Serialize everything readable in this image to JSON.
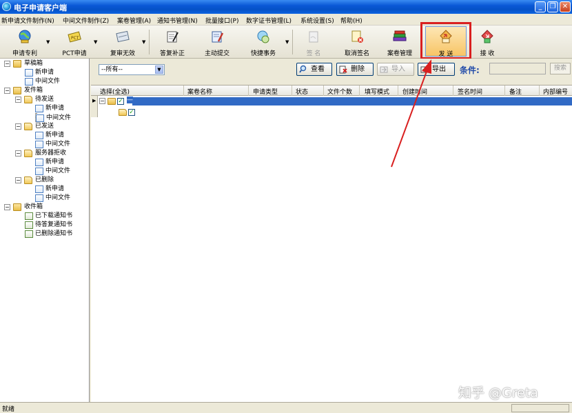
{
  "window": {
    "title": "电子申请客户端",
    "minimize": "_",
    "maximize": "❐",
    "close": "✕"
  },
  "menu": [
    "新申请文件制作(N)",
    "中间文件制作(Z)",
    "案卷管理(A)",
    "通知书管理(N)",
    "批量接口(P)",
    "数字证书管理(L)",
    "系统设置(S)",
    "帮助(H)"
  ],
  "toolbar": {
    "apply_patent": "申请专利",
    "pct_apply": "PCT申请",
    "review_invalid": "复审无效",
    "reply_supplement": "答复补正",
    "active_submit": "主动提交",
    "quick_tasks": "快捷事务",
    "sign": "签 名",
    "cancel_sign": "取消签名",
    "case_manage": "案卷管理",
    "send": "发 送",
    "receive": "接 收"
  },
  "tree": {
    "drafts": "草稿箱",
    "drafts_new": "新申请",
    "drafts_mid": "中间文件",
    "outbox": "发件箱",
    "pending": "待发送",
    "pending_new": "新申请",
    "pending_mid": "中间文件",
    "sent": "已发送",
    "sent_new": "新申请",
    "sent_mid": "中间文件",
    "rejected": "服务器拒收",
    "rejected_new": "新申请",
    "rejected_mid": "中间文件",
    "deleted": "已删除",
    "deleted_new": "新申请",
    "deleted_mid": "中间文件",
    "inbox": "收件箱",
    "downloaded": "已下载通知书",
    "to_reply": "待答复通知书",
    "deleted_notice": "已删除通知书"
  },
  "filter": {
    "select_value": "--所有--",
    "view": "查看",
    "delete": "删除",
    "import": "导入",
    "export": "导出",
    "condition_label": "条件:",
    "search": "搜索"
  },
  "grid": {
    "columns": [
      "选择(全选)",
      "案卷名称",
      "申请类型",
      "状态",
      "文件个数",
      "填写模式",
      "创建时间",
      "签名时间",
      "备注",
      "内部编号"
    ],
    "row1_value": "—"
  },
  "status": {
    "text": "就绪"
  },
  "watermark": "知乎 @Greta",
  "colors": {
    "highlight": "#d91f1f",
    "selection": "#316ac5",
    "title_bar": "#0a58d6"
  }
}
